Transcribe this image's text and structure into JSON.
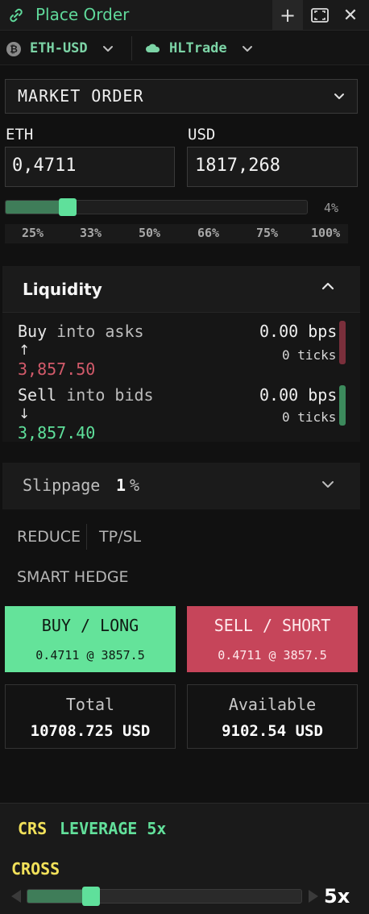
{
  "window": {
    "title": "Place Order",
    "controls": {
      "new": "+",
      "close": "✕"
    }
  },
  "instrument": {
    "pair": "ETH-USD",
    "coin_icon": "bitcoin-coin-icon",
    "coin_glyph": "₿",
    "exchange": "HLTrade",
    "exchange_icon": "cloud-icon"
  },
  "order_type": {
    "selected": "MARKET ORDER"
  },
  "base": {
    "label": "ETH",
    "value": "0,4711"
  },
  "quote": {
    "label": "USD",
    "value": "1817,268"
  },
  "size_slider": {
    "value_percent": 4,
    "display": "4%",
    "presets": [
      "25%",
      "33%",
      "50%",
      "66%",
      "75%",
      "100%"
    ]
  },
  "liquidity": {
    "title": "Liquidity",
    "buy": {
      "verb": "Buy",
      "rest": "into asks",
      "arrow": "↑",
      "price": "3,857.50",
      "bps_value": "0.00",
      "bps_unit": "bps",
      "ticks": "0 ticks"
    },
    "sell": {
      "verb": "Sell",
      "rest": "into bids",
      "arrow": "↓",
      "price": "3,857.40",
      "bps_value": "0.00",
      "bps_unit": "bps",
      "ticks": "0 ticks"
    }
  },
  "slippage": {
    "label": "Slippage",
    "value": "1",
    "unit": "%"
  },
  "options": {
    "reduce": "REDUCE",
    "tpsl": "TP/SL",
    "smart_hedge": "SMART HEDGE"
  },
  "buy_button": {
    "label": "BUY / LONG",
    "detail": "0.4711 @ 3857.5"
  },
  "sell_button": {
    "label": "SELL / SHORT",
    "detail": "0.4711 @ 3857.5"
  },
  "total": {
    "label": "Total",
    "value": "10708.725 USD"
  },
  "available": {
    "label": "Available",
    "value": "9102.54 USD"
  },
  "leverage": {
    "mode_short": "CRS",
    "label": "LEVERAGE 5x",
    "mode": "CROSS",
    "value": "5x",
    "slider_fraction": 0.2
  },
  "colors": {
    "accent_green": "#5fe09b",
    "sell_red": "#c6455a",
    "buy_green": "#64e39a",
    "cross_yellow": "#f2e15a"
  }
}
